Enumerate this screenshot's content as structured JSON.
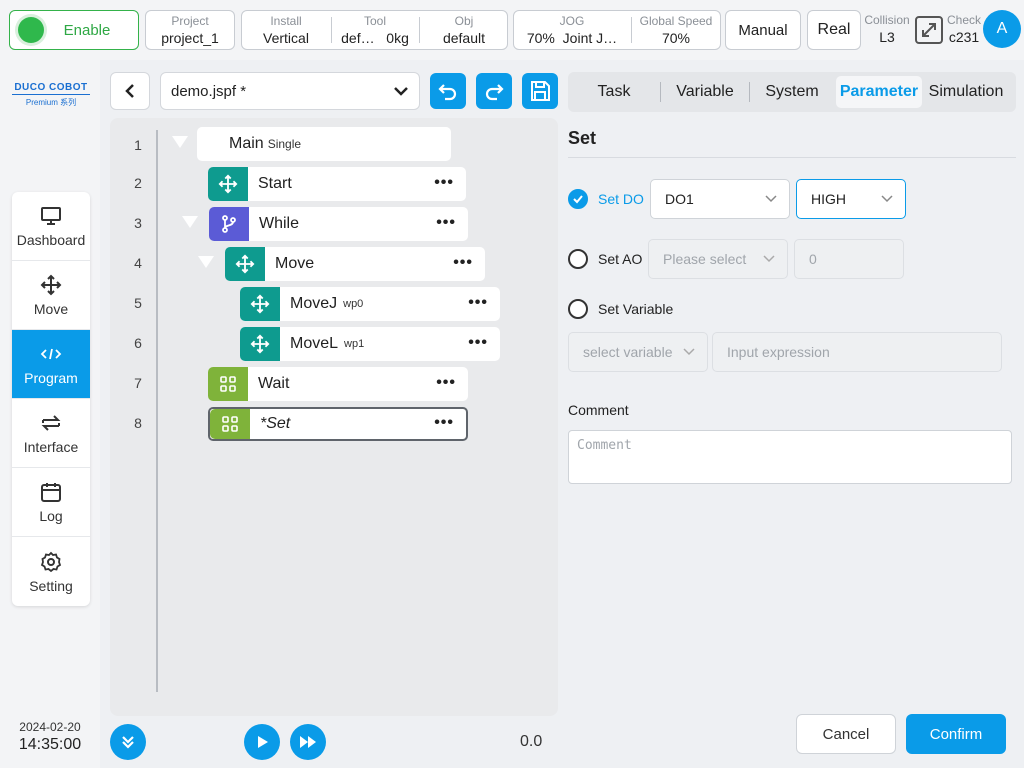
{
  "topbar": {
    "enable_label": "Enable",
    "project": {
      "label": "Project",
      "value": "project_1"
    },
    "install": {
      "label": "Install",
      "value": "Vertical"
    },
    "tool": {
      "label": "Tool",
      "value1": "def…",
      "value2": "0kg"
    },
    "obj": {
      "label": "Obj",
      "value": "default"
    },
    "jog": {
      "label": "JOG",
      "value1": "70%",
      "value2": "Joint J…"
    },
    "global_speed": {
      "label": "Global Speed",
      "value": "70%"
    },
    "mode_button": "Manual",
    "real_button": "Real",
    "collision": {
      "label": "Collision",
      "value": "L3"
    },
    "check": {
      "label": "Check",
      "value": "c231"
    },
    "avatar": "A"
  },
  "logo": {
    "line1": "DUCO COBOT",
    "line2": "Premium 系列"
  },
  "sidebar": {
    "items": [
      {
        "label": "Dashboard",
        "icon": "monitor-icon"
      },
      {
        "label": "Move",
        "icon": "move-icon"
      },
      {
        "label": "Program",
        "icon": "code-icon",
        "active": true
      },
      {
        "label": "Interface",
        "icon": "swap-icon"
      },
      {
        "label": "Log",
        "icon": "calendar-icon"
      },
      {
        "label": "Setting",
        "icon": "gear-icon"
      }
    ],
    "date": "2024-02-20",
    "time": "14:35:00"
  },
  "program": {
    "file_name": "demo.jspf *",
    "lines": [
      {
        "n": "1",
        "label": "Main",
        "sub": "Single"
      },
      {
        "n": "2",
        "label": "Start"
      },
      {
        "n": "3",
        "label": "While"
      },
      {
        "n": "4",
        "label": "Move"
      },
      {
        "n": "5",
        "label": "MoveJ",
        "sub": "wp0"
      },
      {
        "n": "6",
        "label": "MoveL",
        "sub": "wp1"
      },
      {
        "n": "7",
        "label": "Wait"
      },
      {
        "n": "8",
        "label": "*Set"
      }
    ],
    "more": "•••",
    "speed_value": "0.0"
  },
  "tabs": [
    "Task",
    "Variable",
    "System",
    "Parameter",
    "Simulation"
  ],
  "panel": {
    "title": "Set",
    "set_do": {
      "label": "Set DO",
      "port": "DO1",
      "level": "HIGH"
    },
    "set_ao": {
      "label": "Set AO",
      "placeholder": "Please select",
      "value": "0"
    },
    "set_var": {
      "label": "Set Variable",
      "placeholder": "select variable",
      "expr_placeholder": "Input expression"
    },
    "comment_label": "Comment",
    "comment_placeholder": "Comment",
    "cancel": "Cancel",
    "confirm": "Confirm"
  },
  "colors": {
    "accent": "#0a9be8",
    "teal": "#0e9b8f",
    "purple": "#5b5bd6",
    "olive": "#7fb33a",
    "enable": "#2fb84c"
  }
}
